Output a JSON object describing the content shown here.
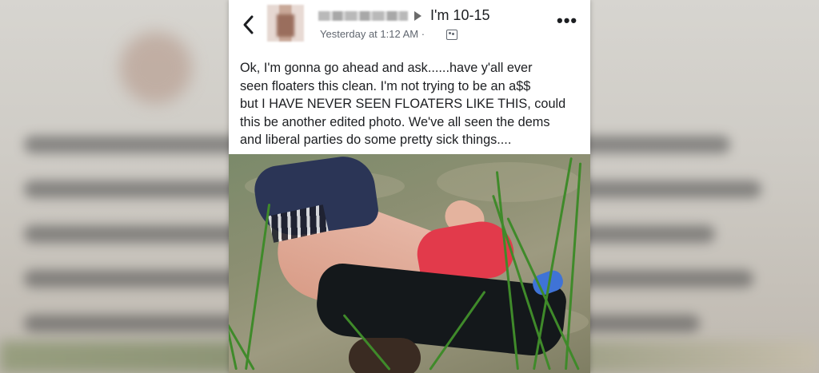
{
  "post": {
    "group_name": "I'm 10-15",
    "timestamp": "Yesterday at 1:12 AM ·",
    "more_label": "•••",
    "text": "Ok, I'm gonna go ahead and ask......have y'all ever\nseen floaters this clean.  I'm not trying to be an a$$\nbut I HAVE NEVER SEEN FLOATERS LIKE THIS,  could\nthis be another edited photo.  We've all seen the dems\nand liberal parties do some pretty sick things...."
  },
  "icons": {
    "back": "chevron-left-icon",
    "arrow": "triangle-right-icon",
    "audience": "audience-icon",
    "more": "more-horizontal-icon"
  },
  "colors": {
    "text": "#1c1e21",
    "meta": "#616770",
    "card": "#ffffff"
  }
}
